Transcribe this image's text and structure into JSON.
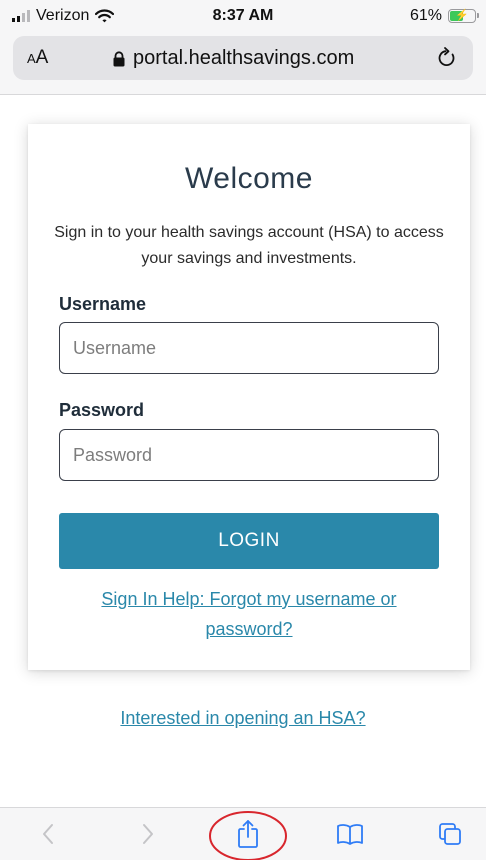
{
  "status_bar": {
    "carrier": "Verizon",
    "time": "8:37 AM",
    "battery_percent_text": "61%",
    "battery_level": 0.61
  },
  "browser": {
    "text_size_button": {
      "large": "A",
      "small": "A"
    },
    "url": "portal.healthsavings.com"
  },
  "login_card": {
    "title": "Welcome",
    "subtitle": "Sign in to your health savings account (HSA) to access your savings and investments.",
    "username": {
      "label": "Username",
      "placeholder": "Username",
      "value": ""
    },
    "password": {
      "label": "Password",
      "placeholder": "Password",
      "value": ""
    },
    "login_button": "LOGIN",
    "help_link": "Sign In Help: Forgot my username or password?"
  },
  "open_hsa_link": "Interested in opening an HSA?",
  "toolbar": {
    "icons": [
      "back-arrow-icon",
      "forward-arrow-icon",
      "share-icon",
      "bookmarks-icon",
      "tabs-icon"
    ],
    "highlighted": "share-icon"
  },
  "colors": {
    "accent": "#2a88aa",
    "annotation": "#d8262d",
    "battery_fill": "#3bc85a"
  }
}
